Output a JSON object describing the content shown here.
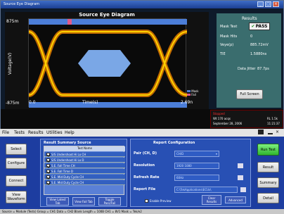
{
  "window": {
    "title": "Source Eye Diagram",
    "controls": [
      "_",
      "□",
      "×"
    ]
  },
  "plot": {
    "title": "Source Eye Diagram",
    "y_top": "875m",
    "y_bottom": "-875m",
    "y_label": "Voltage(V)",
    "x_left": "0.0",
    "x_right": "2.69n",
    "x_label": "Time(s)",
    "legend": [
      "Mask",
      "Fail"
    ]
  },
  "results": {
    "header": "Results",
    "mask_test_label": "Mask Test",
    "mask_test_value": "PASS",
    "mask_hits_label": "Mask Hits",
    "mask_hits_value": "0",
    "veye_label": "Veye(p)",
    "veye_value": "885.72mV",
    "teye_label": "TIE",
    "teye_value": "1.5880ns",
    "data_jitter_label": "Data Jitter",
    "data_jitter_value": "87.7ps",
    "full_screen": "Full Screen"
  },
  "status_red": {
    "line1": "Stopped",
    "line2": "Wt 170 acqs",
    "line3": "September 28, 2006",
    "right1": "RL 1.5k",
    "right2": "11:21:37"
  },
  "menu": [
    "File",
    "Tests",
    "Results",
    "Utilities",
    "Help"
  ],
  "left_buttons": [
    "Select",
    "Configure",
    "Connect",
    "View Waveform"
  ],
  "summary": {
    "header": "Result Summary Source",
    "col": "Test Name",
    "rows": [
      {
        "label": "S/S Undershoot Hi Lo CH",
        "checked": true
      },
      {
        "label": "S/S Undershoot Hi Lo D",
        "checked": true
      },
      {
        "label": "S.E. Fall Time CH",
        "checked": true
      },
      {
        "label": "S.E. Fall Time D",
        "checked": true
      },
      {
        "label": "S.E. Mid Duty Cycle CH",
        "checked": true
      },
      {
        "label": "S.E. Mid Duty Cycle CH",
        "checked": true
      }
    ],
    "buttons": [
      "View Latest Tab",
      "View Fail Tab",
      "Toggle Pass/Fail"
    ]
  },
  "config": {
    "header": "Report Configuration",
    "pair_label": "Pair (CH, D)",
    "pair_value": "CH/D",
    "resolution_label": "Resolution",
    "resolution_value": "1920 1080",
    "refresh_label": "Refresh Rate",
    "refresh_value": "60Hz",
    "report_label": "Report File",
    "report_value": "C:\\TekApplications\\ECUs\\",
    "enable_preview": "Enable Preview",
    "clear_results": "Clear Results",
    "advanced": "Advanced"
  },
  "right_buttons": [
    "Run Test",
    "Result",
    "Summary",
    "Detail"
  ],
  "statusbar": "Source = Module (Tests)        Group = CH1  Data = CH2  Blank Length = 100B  CH1 = 8V1  Mask = Tek/e2"
}
